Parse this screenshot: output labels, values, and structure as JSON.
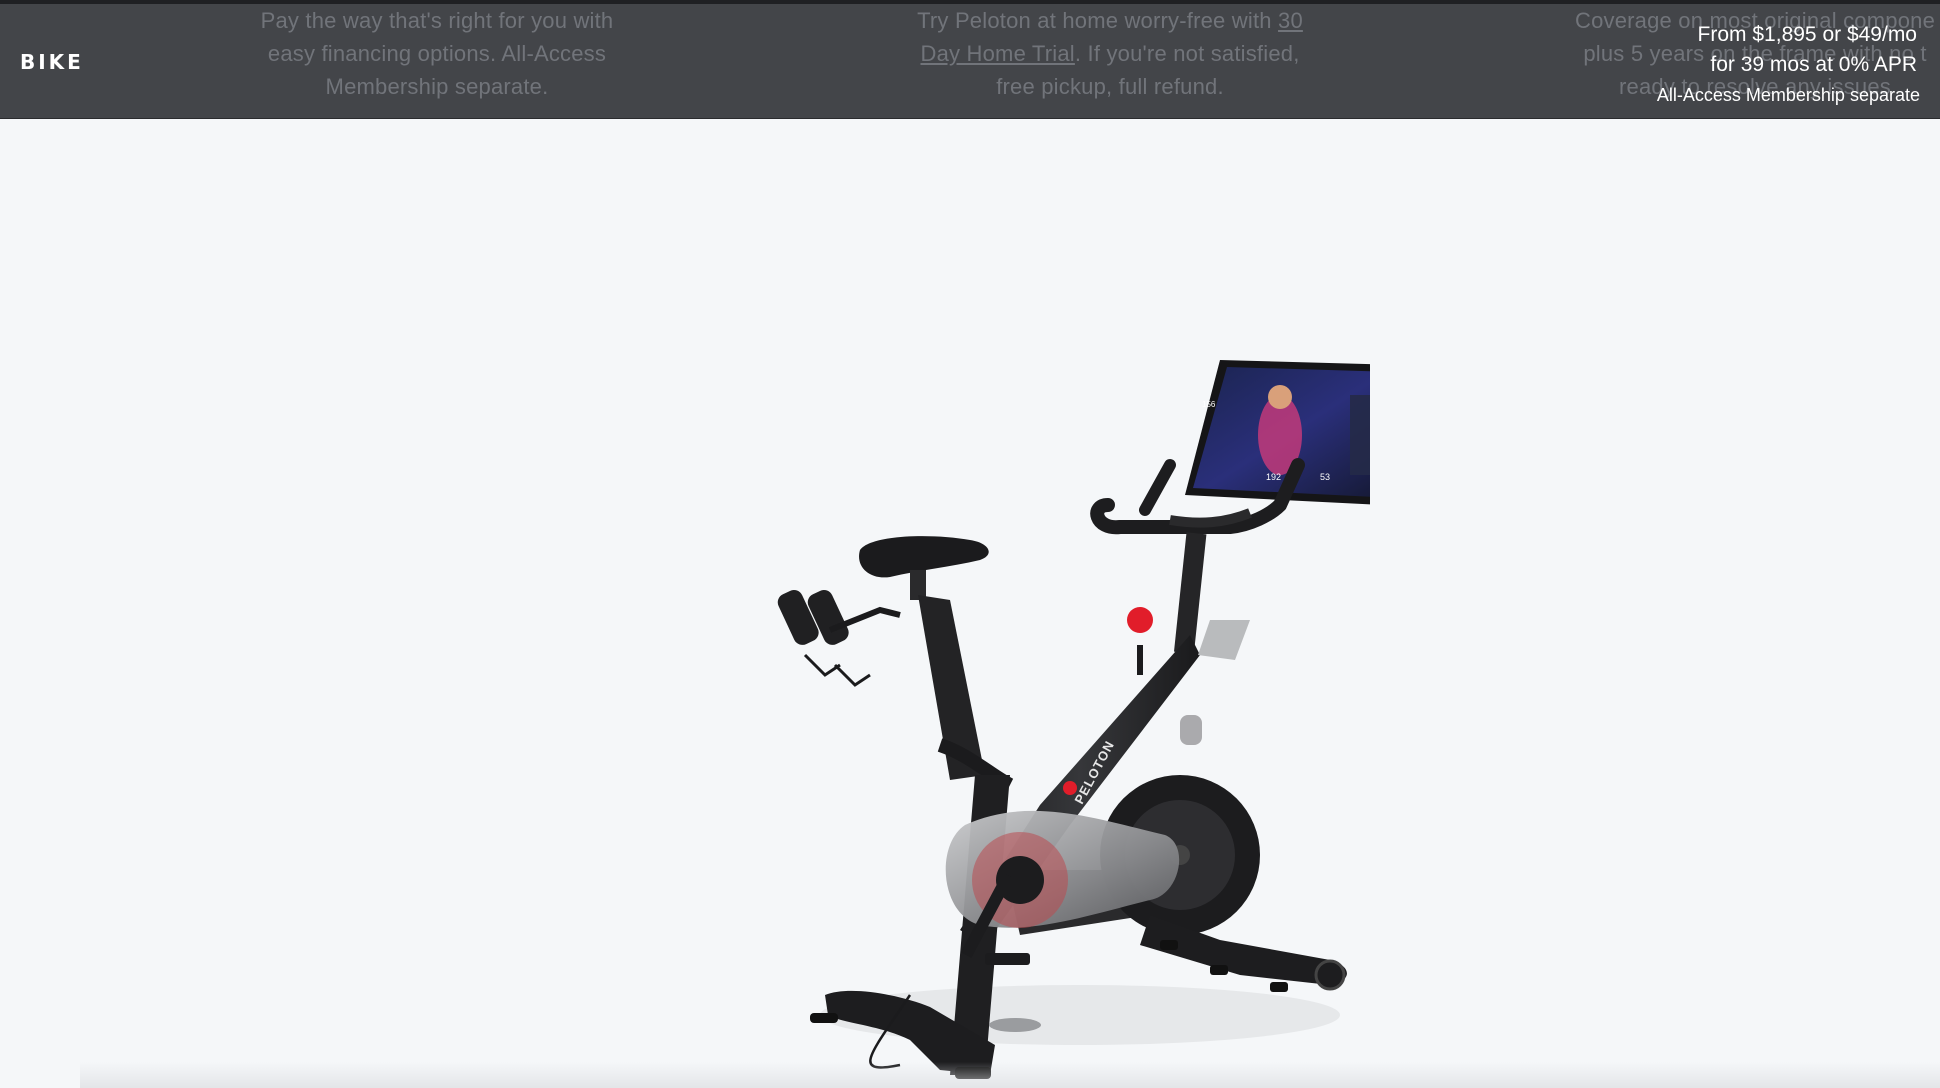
{
  "header": {
    "product_label": "BIKE",
    "promo_financing": {
      "line1": "Pay the way that's right for you with",
      "line2": "easy financing options. All-Access",
      "line3": "Membership separate."
    },
    "promo_trial": {
      "line1_prefix": "Try Peloton at home worry-free with ",
      "line1_link": "30",
      "line2_link": "Day Home Trial",
      "line2_suffix": ". If you're not satisfied,",
      "line3": "free pickup, full refund."
    },
    "promo_coverage": {
      "line1": "Coverage on most original compone",
      "line2": "plus 5 years on the frame with no t",
      "line3": "ready to resolve any issues"
    },
    "price": {
      "line1": "From $1,895 or $49/mo",
      "line2": "for 39 mos at 0% APR",
      "note": "All-Access Membership separate"
    }
  },
  "product_image": {
    "brand_text": "PELOTON",
    "screen_stats": [
      "156",
      "192",
      "53"
    ]
  },
  "colors": {
    "header_bg": "#434549",
    "page_bg": "#f5f7f9",
    "accent_red": "#e11d2a"
  }
}
